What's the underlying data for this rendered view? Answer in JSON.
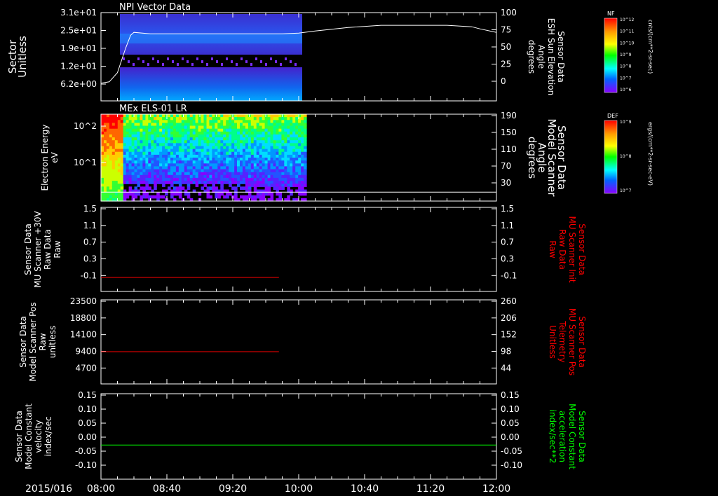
{
  "figure": {
    "date_label": "2015/016",
    "time_ticks": [
      "08:00",
      "08:40",
      "09:20",
      "10:00",
      "10:40",
      "11:20",
      "12:00"
    ],
    "colors": {
      "bg": "#000000",
      "axis": "#ffffff",
      "red": "#ff0000",
      "green": "#00ff00"
    }
  },
  "chart_data": [
    {
      "type": "heatmap",
      "title": "NPI Vector Data",
      "ylabel_left": [
        "Sector",
        "Unitless"
      ],
      "yticks_left": [
        "3.1e+01",
        "2.5e+01",
        "1.9e+01",
        "1.2e+01",
        "6.2e+00"
      ],
      "ylabel_right": [
        "Sensor Data",
        "ESH Sun Elevation",
        "Angle",
        "degrees"
      ],
      "yticks_right": [
        "100",
        "75",
        "50",
        "25",
        "0"
      ],
      "ylim_right": [
        -25,
        100
      ],
      "overlay_line": {
        "name": "ESH Sun Elevation Angle",
        "x_min": [
          0,
          5,
          10,
          15,
          18,
          20,
          30,
          60,
          90,
          110,
          120,
          130,
          150,
          170,
          190,
          210,
          225,
          230,
          240
        ],
        "values": [
          0,
          2,
          15,
          50,
          68,
          72,
          70,
          70,
          70,
          70,
          71,
          74,
          79,
          82,
          82,
          82,
          80,
          77,
          72
        ]
      },
      "colorbar": {
        "label": "NF",
        "unit": "cnts/(cm**2-sr-sec)",
        "ticks": [
          "10^12",
          "10^11",
          "10^10",
          "10^9",
          "10^8",
          "10^7",
          "10^6"
        ]
      }
    },
    {
      "type": "heatmap",
      "title": "MEx ELS-01 LR",
      "ylabel_left": [
        "Electron Energy",
        "eV"
      ],
      "yticks_left": [
        "10^2",
        "10^1"
      ],
      "ylabel_right": [
        "Sensor Data",
        "Model Scanner",
        "Angle",
        "degrees"
      ],
      "yticks_right": [
        "190",
        "150",
        "110",
        "70",
        "30"
      ],
      "ylim_right": [
        -5,
        190
      ],
      "overlay_line": {
        "name": "Model Scanner Angle",
        "x_min": [
          0,
          240
        ],
        "values": [
          15,
          15
        ]
      },
      "colorbar": {
        "label": "DEF",
        "unit": "ergs/(cm**2-sr-sec-eV)",
        "ticks": [
          "10^9",
          "10^8",
          "10^7"
        ]
      }
    },
    {
      "type": "line",
      "ylabel_left": [
        "Sensor Data",
        "MU Scanner +30V",
        "Raw Data",
        "Raw"
      ],
      "yticks_left": [
        "1.5",
        "1.1",
        "0.7",
        "0.3",
        "-0.1"
      ],
      "ylim_left": [
        -0.3,
        1.5
      ],
      "ylabel_right": [
        "Sensor Data",
        "MU Scanner Init",
        "Raw Data",
        "Raw"
      ],
      "yticks_right": [
        "1.5",
        "1.1",
        "0.7",
        "0.3",
        "-0.1"
      ],
      "ylim_right": [
        -0.3,
        1.5
      ],
      "series": [
        {
          "x_min": [
            0,
            108
          ],
          "values": [
            0,
            0
          ],
          "color": "#ff0000"
        }
      ]
    },
    {
      "type": "line",
      "ylabel_left": [
        "Sensor Data",
        "Model Scanner Pos",
        "Raw",
        "unitless"
      ],
      "yticks_left": [
        "23500",
        "18800",
        "14100",
        "9400",
        "4700"
      ],
      "ylim_left": [
        0,
        23500
      ],
      "ylabel_right": [
        "Sensor Data",
        "MU Scanner Pos",
        "Telemetry",
        "Unitless"
      ],
      "yticks_right": [
        "260",
        "206",
        "152",
        "98",
        "44"
      ],
      "ylim_right": [
        0,
        260
      ],
      "series": [
        {
          "x_min": [
            0,
            108
          ],
          "values": [
            9000,
            9000
          ],
          "color": "#ff0000"
        }
      ]
    },
    {
      "type": "line",
      "ylabel_left": [
        "Sensor Data",
        "Model Constant",
        "velocity",
        "index/sec"
      ],
      "yticks_left": [
        "0.15",
        "0.10",
        "0.05",
        "0.00",
        "-0.05",
        "-0.10"
      ],
      "ylim_left": [
        -0.1,
        0.15
      ],
      "ylabel_right": [
        "Sensor Data",
        "Model Constant",
        "acceleration",
        "index/sec**2"
      ],
      "yticks_right": [
        "0.15",
        "0.10",
        "0.05",
        "0.00",
        "-0.05",
        "-0.10"
      ],
      "ylim_right": [
        -0.1,
        0.15
      ],
      "series": [
        {
          "x_min": [
            0,
            240
          ],
          "values": [
            0,
            0
          ],
          "color": "#00ff00"
        }
      ]
    }
  ]
}
